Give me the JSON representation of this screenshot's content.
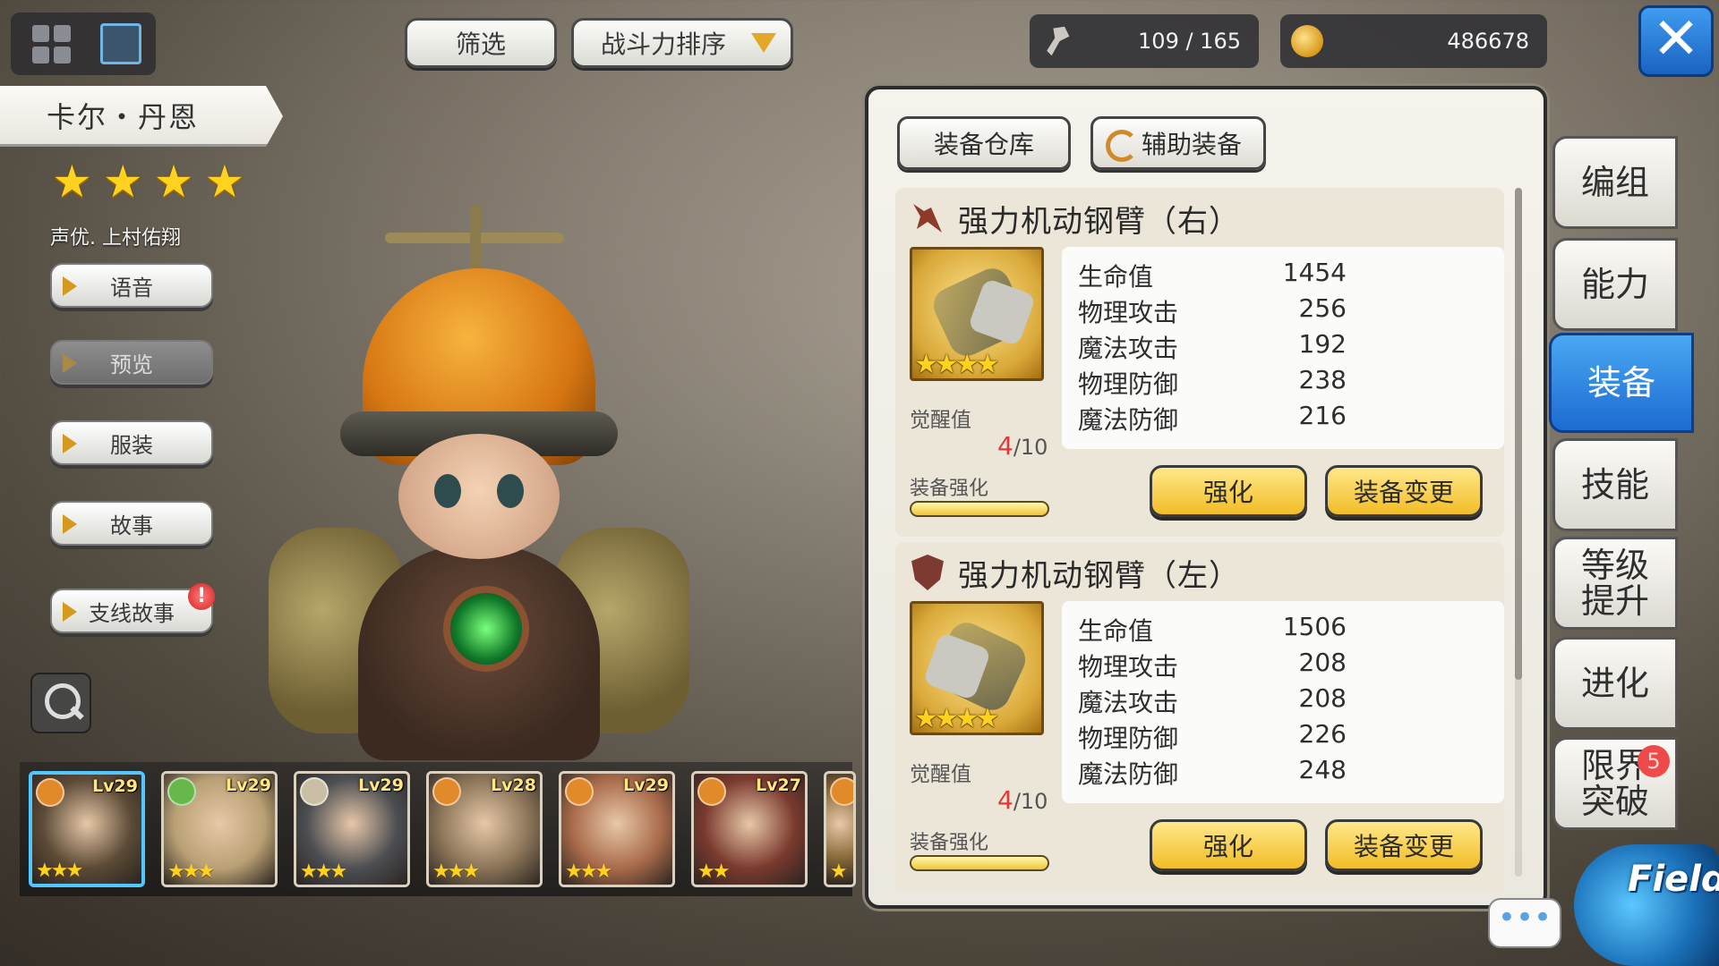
{
  "top": {
    "filter_label": "筛选",
    "sort_label": "战斗力排序",
    "stamina": "109 / 165",
    "gold": "486678"
  },
  "character": {
    "name": "卡尔・丹恩",
    "stars": 4,
    "voice_actor": "声优. 上村佑翔",
    "buttons": {
      "voice": "语音",
      "preview": "预览",
      "costume": "服装",
      "story": "故事",
      "side_story": "支线故事"
    },
    "side_story_badge": "!"
  },
  "roster": [
    {
      "level": "Lv29",
      "stars": "★★★",
      "elem_color": "#e08a2a",
      "portrait_color": "#5b4a36"
    },
    {
      "level": "Lv29",
      "stars": "★★★",
      "elem_color": "#66b84a",
      "portrait_color": "#b9a074"
    },
    {
      "level": "Lv29",
      "stars": "★★★",
      "elem_color": "#c9bfa4",
      "portrait_color": "#4c4e52"
    },
    {
      "level": "Lv28",
      "stars": "★★★",
      "elem_color": "#e08a2a",
      "portrait_color": "#8a7458"
    },
    {
      "level": "Lv29",
      "stars": "★★★",
      "elem_color": "#e08a2a",
      "portrait_color": "#a86a4a"
    },
    {
      "level": "Lv27",
      "stars": "★★",
      "elem_color": "#e08a2a",
      "portrait_color": "#7a3a2e"
    },
    {
      "level": "",
      "stars": "★",
      "elem_color": "#e08a2a",
      "portrait_color": "#8a6a3a"
    }
  ],
  "panel": {
    "tab_warehouse": "装备仓库",
    "tab_aux": "辅助装备",
    "items": [
      {
        "title": "强力机动钢臂（右）",
        "stars": "★★★★",
        "stats": [
          {
            "name": "生命值",
            "value": "1454"
          },
          {
            "name": "物理攻击",
            "value": "256"
          },
          {
            "name": "魔法攻击",
            "value": "192"
          },
          {
            "name": "物理防御",
            "value": "238"
          },
          {
            "name": "魔法防御",
            "value": "216"
          }
        ],
        "awaken_label": "觉醒值",
        "awaken_current": "4",
        "awaken_max": "/10",
        "enhance_label": "装备强化",
        "enhance_btn": "强化",
        "change_btn": "装备变更"
      },
      {
        "title": "强力机动钢臂（左）",
        "stars": "★★★★",
        "stats": [
          {
            "name": "生命值",
            "value": "1506"
          },
          {
            "name": "物理攻击",
            "value": "208"
          },
          {
            "name": "魔法攻击",
            "value": "208"
          },
          {
            "name": "物理防御",
            "value": "226"
          },
          {
            "name": "魔法防御",
            "value": "248"
          }
        ],
        "awaken_label": "觉醒值",
        "awaken_current": "4",
        "awaken_max": "/10",
        "enhance_label": "装备强化",
        "enhance_btn": "强化",
        "change_btn": "装备变更"
      }
    ]
  },
  "menu": {
    "team": "编组",
    "ability": "能力",
    "equipment": "装备",
    "skill": "技能",
    "levelup": "等级\n提升",
    "evolve": "进化",
    "limit_break": "限界\n突破",
    "limit_break_badge": "5",
    "field_label": "Field",
    "chat_label": "•••"
  }
}
